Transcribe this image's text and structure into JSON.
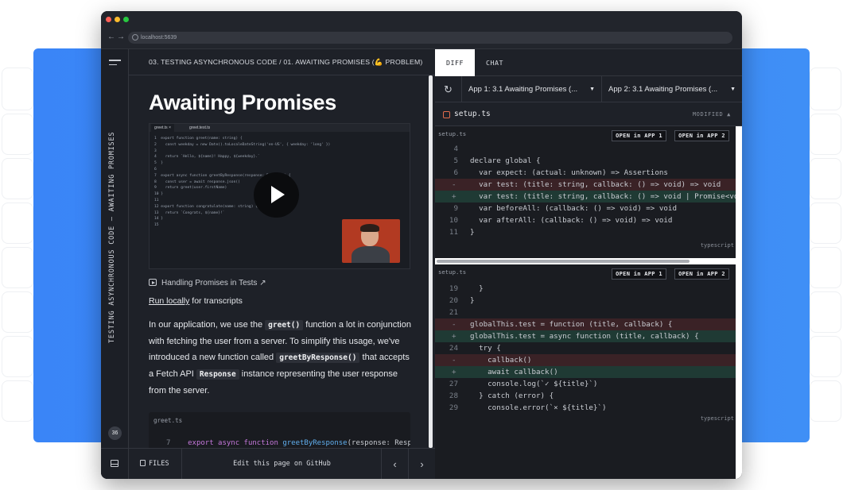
{
  "browser": {
    "url": "localhost:5639"
  },
  "sidebar": {
    "vertical_title": "TESTING ASYNCHRONOUS CODE – AWAITING PROMISES",
    "badge": "36"
  },
  "breadcrumb": {
    "text": "03. TESTING ASYNCHRONOUS CODE  /  01. AWAITING PROMISES (💪 PROBLEM)"
  },
  "lesson": {
    "title": "Awaiting Promises",
    "video_link": "Handling Promises in Tests ↗",
    "run_locally_link": "Run locally",
    "run_locally_rest": " for transcripts",
    "para": {
      "p1": "In our application, we use the ",
      "code1": "greet()",
      "p2": " function a lot in conjunction with fetching the user from a server. To simplify this usage, we've introduced a new function called ",
      "code2": "greetByResponse()",
      "p3": " that accepts a Fetch API ",
      "code3": "Response",
      "p4": " instance representing the user response from the server."
    },
    "codebox": {
      "filename": "greet.ts",
      "line_num": "7",
      "line_kw": "export async function ",
      "line_fn": "greetByResponse",
      "line_rest": "(response: Respor"
    }
  },
  "video": {
    "tabs": [
      "greet.ts  ×",
      "greet.test.ts"
    ],
    "lines": [
      "1  export function greet(name: string) {",
      "2    const weekday = new Date().toLocaleDateString('en-US', { weekday: 'long' })",
      "3",
      "4    return `Hello, ${name}! Happy, ${weekday}.`",
      "5  }",
      "6",
      "7  export async function greetByResponse(response: Response) {",
      "8    const user = await response.json()",
      "9    return greet(user.firstName)",
      "10 }",
      "11",
      "12 export function congratulate(name: string) {",
      "13   return `Congrats, ${name}!`",
      "14 }",
      "15"
    ]
  },
  "footer": {
    "files": "FILES",
    "edit": "Edit this page on GitHub",
    "prev": "‹",
    "next": "›"
  },
  "right": {
    "tabs": {
      "diff": "DIFF",
      "chat": "CHAT"
    },
    "app1": "App 1: 3.1 Awaiting Promises (...",
    "app2": "App 2: 3.1 Awaiting Promises (...",
    "file": "setup.ts",
    "modified": "MODIFIED ▲",
    "open1": "OPEN in APP 1",
    "open2": "OPEN in APP 2",
    "lang": "typescript",
    "pane1": {
      "filename": "setup.ts",
      "lines": [
        {
          "n": "4",
          "t": "ctx",
          "s": "",
          "c": ""
        },
        {
          "n": "5",
          "t": "ctx",
          "s": "",
          "c": "declare global {"
        },
        {
          "n": "6",
          "t": "ctx",
          "s": "",
          "c": "  var expect: (actual: unknown) => Assertions"
        },
        {
          "n": "",
          "t": "del",
          "s": "-",
          "c": "  var test: (title: string, callback: () => void) => void"
        },
        {
          "n": "",
          "t": "add",
          "s": "+",
          "c": "  var test: (title: string, callback: () => void | Promise<void"
        },
        {
          "n": "9",
          "t": "ctx",
          "s": "",
          "c": "  var beforeAll: (callback: () => void) => void"
        },
        {
          "n": "10",
          "t": "ctx",
          "s": "",
          "c": "  var afterAll: (callback: () => void) => void"
        },
        {
          "n": "11",
          "t": "ctx",
          "s": "",
          "c": "}"
        }
      ]
    },
    "pane2": {
      "filename": "setup.ts",
      "lines": [
        {
          "n": "19",
          "t": "ctx",
          "s": "",
          "c": "  }"
        },
        {
          "n": "20",
          "t": "ctx",
          "s": "",
          "c": "}"
        },
        {
          "n": "21",
          "t": "ctx",
          "s": "",
          "c": ""
        },
        {
          "n": "",
          "t": "del",
          "s": "-",
          "c": "globalThis.test = function (title, callback) {"
        },
        {
          "n": "",
          "t": "add",
          "s": "+",
          "c": "globalThis.test = async function (title, callback) {"
        },
        {
          "n": "24",
          "t": "ctx",
          "s": "",
          "c": "  try {"
        },
        {
          "n": "",
          "t": "del",
          "s": "-",
          "c": "    callback()"
        },
        {
          "n": "",
          "t": "add",
          "s": "+",
          "c": "    await callback()"
        },
        {
          "n": "27",
          "t": "ctx",
          "s": "",
          "c": "    console.log(`✓ ${title}`)"
        },
        {
          "n": "28",
          "t": "ctx",
          "s": "",
          "c": "  } catch (error) {"
        },
        {
          "n": "29",
          "t": "ctx",
          "s": "",
          "c": "    console.error(`× ${title}`)"
        }
      ]
    }
  },
  "colors": {
    "accent": "#3b82f6",
    "bg": "#1e2128",
    "add": "#1f3a34",
    "del": "#3a2226"
  }
}
